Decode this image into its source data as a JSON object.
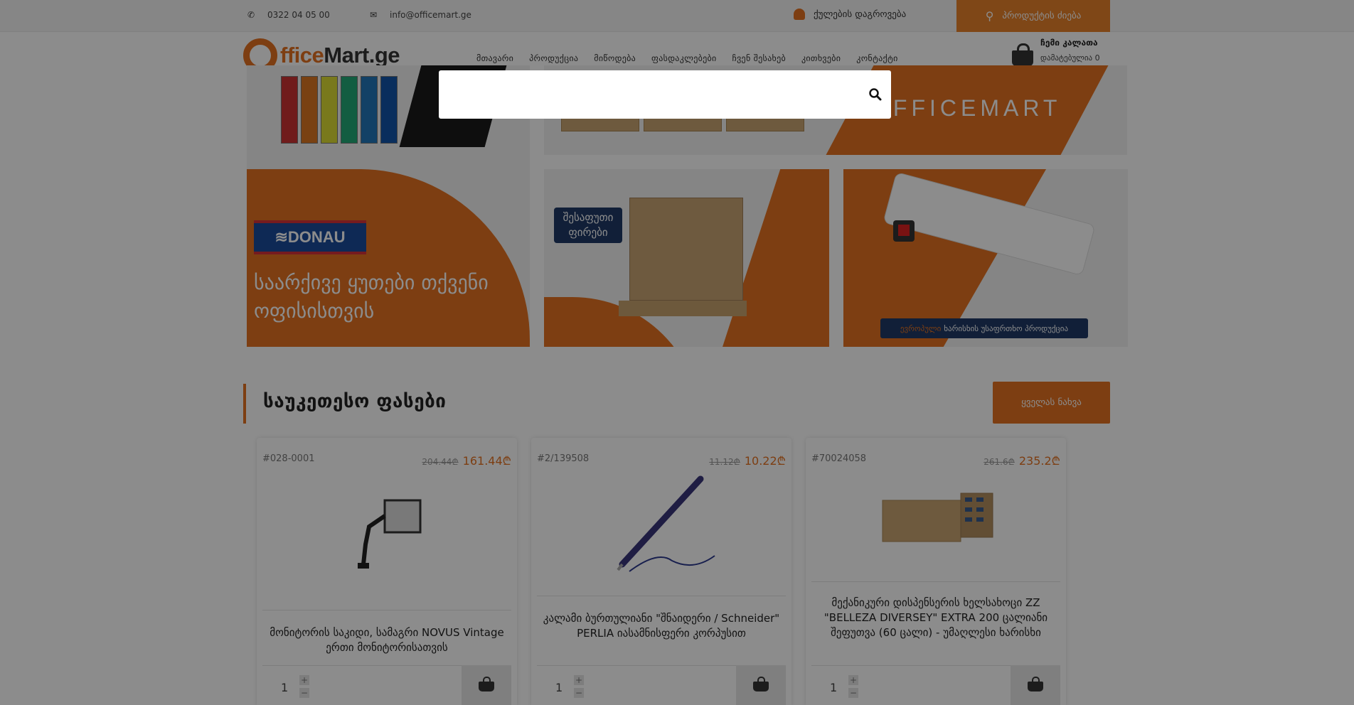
{
  "topbar": {
    "phone": "0322 04 05 00",
    "email": "info@officemart.ge",
    "order": "ქულების დაგროვება",
    "search_button": "პროდუქტის ძიება"
  },
  "logo": {
    "office": "ffice",
    "mart": "Mart.ge"
  },
  "nav": [
    "მთავარი",
    "პროდუქცია",
    "მიწოდება",
    "ფასდაკლებები",
    "ჩვენ შესახებ",
    "კითხვები",
    "კონტაქტი"
  ],
  "cart": {
    "title": "ჩემი კალათა",
    "added": "დამატებულია 0",
    "sum": "0",
    "currency": "₾"
  },
  "banners": {
    "left_brand": "≋DONAU",
    "left_headline": "საარქივე ყუთები თქვენი ოფისისთვის",
    "top_word": "OFFICEMART",
    "mid_label": "შესაფუთი ფირები",
    "right_caption_highlight": "ევროპული",
    "right_caption": "ხარისხის უსაფრთხო პროდუქცია"
  },
  "section": {
    "title": "საუკეთესო ფასები",
    "see_all": "ყველას ნახვა"
  },
  "products": [
    {
      "code": "#028-0001",
      "old_price": "204.44₾",
      "price": "161.44₾",
      "name": "მონიტორის საკიდი, სამაგრი NOVUS Vintage ერთი მონიტორისათვის",
      "qty": "1"
    },
    {
      "code": "#2/139508",
      "old_price": "11.12₾",
      "price": "10.22₾",
      "name": "კალამი ბურთულიანი \"შნაიდერი / Schneider\" PERLIA იასამნისფერი კორპუსით",
      "qty": "1"
    },
    {
      "code": "#70024058",
      "old_price": "261.6₾",
      "price": "235.2₾",
      "name": "მექანიკური დისპენსერის ხელსახოცი ZZ \"BELLEZA DIVERSEY\" EXTRA 200 ცალიანი შეფუთვა (60 ცალი) - უმაღლესი ხარისხი",
      "qty": "1"
    }
  ],
  "search_modal": {
    "placeholder": ""
  }
}
